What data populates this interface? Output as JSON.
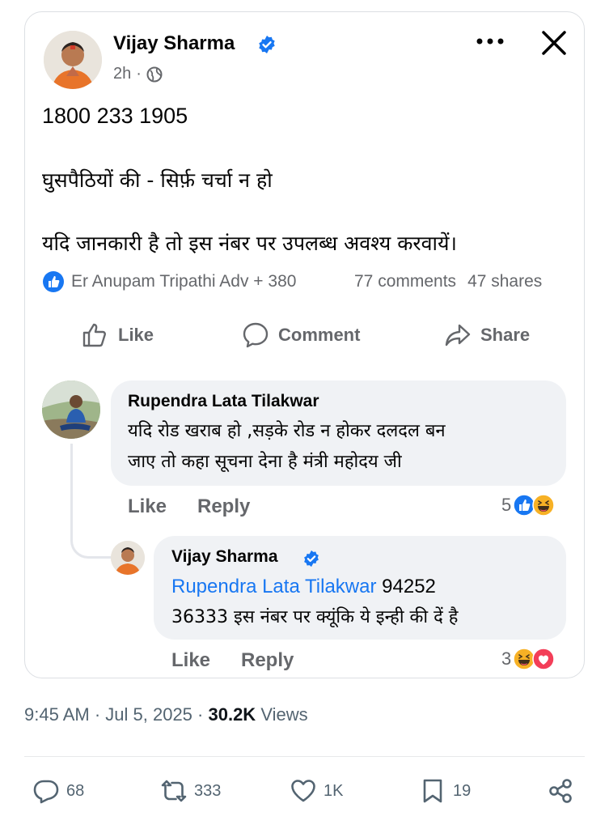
{
  "post": {
    "author": "Vijay Sharma",
    "time": "2h",
    "line1": "1800 233 1905",
    "line2": "घुसपैठियों की - सिर्फ़ चर्चा न हो",
    "line3": "यदि जानकारी है तो इस नंबर पर उपलब्ध अवश्य  करवायें।",
    "reactors": "Er Anupam Tripathi Adv + 380",
    "comments": "77 comments",
    "shares": "47 shares"
  },
  "actions": {
    "like": "Like",
    "comment": "Comment",
    "share": "Share"
  },
  "comment1": {
    "name": "Rupendra Lata Tilakwar",
    "line1": "यदि रोड खराब हो ,सड़के रोड न होकर दलदल बन",
    "line2": "जाए तो कहा सूचना देना है मंत्री महोदय जी",
    "like": "Like",
    "reply": "Reply",
    "count": "5"
  },
  "reply1": {
    "name": "Vijay Sharma",
    "mention": "Rupendra Lata Tilakwar",
    "line1_rest": " 94252",
    "line2": "36333 इस नंबर पर क्यूंकि ये इन्ही की दें है",
    "like": "Like",
    "reply": "Reply",
    "count": "3"
  },
  "tweet": {
    "time": "9:45 AM",
    "date": "Jul 5, 2025",
    "views_count": "30.2K",
    "views_label": "Views",
    "replies": "68",
    "retweets": "333",
    "likes": "1K",
    "bookmarks": "19"
  },
  "colors": {
    "accent": "#1877f2",
    "muted": "#65676b",
    "bubble": "#f0f2f5"
  }
}
